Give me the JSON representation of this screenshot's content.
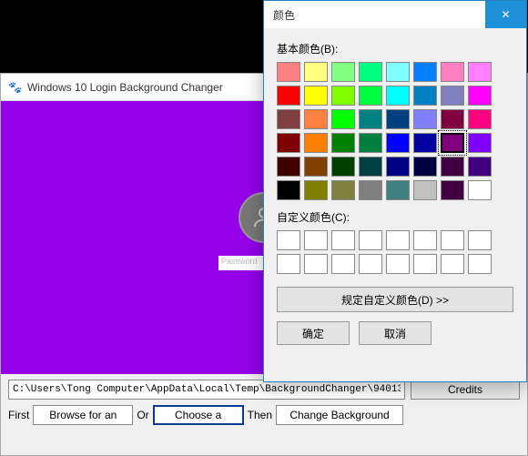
{
  "main": {
    "title": "Windows 10 Login Background Changer",
    "close_label": "×",
    "preview_bg": "#9400E8",
    "password_placeholder": "Password",
    "path_value": "C:\\Users\\Tong Computer\\AppData\\Local\\Temp\\BackgroundChanger\\94013",
    "credits_label": "Credits",
    "first_label": "First",
    "browse_label": "Browse for an",
    "or_label": "Or",
    "choose_label": "Choose a",
    "then_label": "Then",
    "change_label": "Change Background"
  },
  "color_dialog": {
    "title": "颜色",
    "close_label": "✕",
    "basic_label": "基本颜色(B):",
    "custom_label": "自定义颜色(C):",
    "define_label": "规定自定义颜色(D) >>",
    "ok_label": "确定",
    "cancel_label": "取消",
    "basic_colors": [
      [
        "#FF8080",
        "#FFFF80",
        "#80FF80",
        "#00FF80",
        "#80FFFF",
        "#0080FF",
        "#FF80C0",
        "#FF80FF"
      ],
      [
        "#FF0000",
        "#FFFF00",
        "#80FF00",
        "#00FF40",
        "#00FFFF",
        "#0080C0",
        "#8080C0",
        "#FF00FF"
      ],
      [
        "#804040",
        "#FF8040",
        "#00FF00",
        "#008080",
        "#004080",
        "#8080FF",
        "#800040",
        "#FF0080"
      ],
      [
        "#800000",
        "#FF8000",
        "#008000",
        "#008040",
        "#0000FF",
        "#0000A0",
        "#800080",
        "#8000FF"
      ],
      [
        "#400000",
        "#804000",
        "#004000",
        "#004040",
        "#000080",
        "#000040",
        "#400040",
        "#400080"
      ],
      [
        "#000000",
        "#808000",
        "#808040",
        "#808080",
        "#408080",
        "#C0C0C0",
        "#400040",
        "#FFFFFF"
      ]
    ],
    "selected_index": [
      3,
      6
    ],
    "custom_count": 16
  }
}
